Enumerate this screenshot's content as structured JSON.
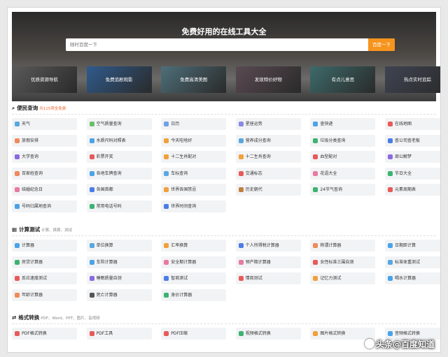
{
  "hero": {
    "title": "免费好用的在线工具大全",
    "search_placeholder": "随时百度一下",
    "search_button": "百度一下"
  },
  "categories": [
    {
      "label": "优质资源导航",
      "color": "#5a5a5a"
    },
    {
      "label": "免费追剧观影",
      "color": "#2f5b8c"
    },
    {
      "label": "免费高清美图",
      "color": "#4e6f7a"
    },
    {
      "label": "发现特价好物",
      "color": "#5a4a52"
    },
    {
      "label": "有点儿意思",
      "color": "#3d6a6a"
    },
    {
      "label": "热点实时追踪",
      "color": "#3f4452"
    }
  ],
  "sections": [
    {
      "title": "便民查询",
      "badge": "共115项全免费",
      "sub": "",
      "icon": "search-icon",
      "items": [
        {
          "label": "天气",
          "color": "#5aa7e0"
        },
        {
          "label": "空气质量查询",
          "color": "#6bbf6b"
        },
        {
          "label": "日历",
          "color": "#6fa0e8"
        },
        {
          "label": "星座运势",
          "color": "#8a8ae0"
        },
        {
          "label": "查快递",
          "color": "#4aa3e8"
        },
        {
          "label": "在线地图",
          "color": "#e85a5a"
        },
        {
          "label": "放假安排",
          "color": "#f08a5a"
        },
        {
          "label": "水质尺码对照表",
          "color": "#4aa3e8"
        },
        {
          "label": "今天吃啥好",
          "color": "#f0a03c"
        },
        {
          "label": "营养成分查询",
          "color": "#5aa7e0"
        },
        {
          "label": "垃圾分类查询",
          "color": "#3cb371"
        },
        {
          "label": "查公司查老板",
          "color": "#4a7de8"
        },
        {
          "label": "大学查询",
          "color": "#8a6ae0"
        },
        {
          "label": "彩票开奖",
          "color": "#e85a5a"
        },
        {
          "label": "十二生肖配对",
          "color": "#f0a03c"
        },
        {
          "label": "十二生肖查询",
          "color": "#f0a03c"
        },
        {
          "label": "血型配对",
          "color": "#e85a5a"
        },
        {
          "label": "周公解梦",
          "color": "#8a6ae0"
        },
        {
          "label": "百家姓查询",
          "color": "#f08a5a"
        },
        {
          "label": "各地车牌查询",
          "color": "#4aa3e8"
        },
        {
          "label": "车标查询",
          "color": "#5aa7e0"
        },
        {
          "label": "交通标志",
          "color": "#e85a5a"
        },
        {
          "label": "花语大全",
          "color": "#e87aa0"
        },
        {
          "label": "节日大全",
          "color": "#3cb371"
        },
        {
          "label": "结婚纪念日",
          "color": "#e87aa0"
        },
        {
          "label": "各国首都",
          "color": "#4a7de8"
        },
        {
          "label": "世界各国禁忌",
          "color": "#f0a03c"
        },
        {
          "label": "历史朝代",
          "color": "#c08040"
        },
        {
          "label": "24节气查询",
          "color": "#3cb371"
        },
        {
          "label": "元素周期表",
          "color": "#e85a5a"
        },
        {
          "label": "号码归属地查询",
          "color": "#4aa3e8"
        },
        {
          "label": "常用电话号码",
          "color": "#3cb371"
        },
        {
          "label": "世界时间查询",
          "color": "#4a7de8"
        }
      ]
    },
    {
      "title": "计算测试",
      "badge": "",
      "sub": "计算、换算、测试",
      "icon": "calculator-icon",
      "items": [
        {
          "label": "计算器",
          "color": "#4aa3e8"
        },
        {
          "label": "单位换算",
          "color": "#5aa7e0"
        },
        {
          "label": "汇率换算",
          "color": "#f0a03c"
        },
        {
          "label": "个人所得税计算器",
          "color": "#4a7de8"
        },
        {
          "label": "称谓计算器",
          "color": "#f08a5a"
        },
        {
          "label": "日期距计算",
          "color": "#4aa3e8"
        },
        {
          "label": "房贷计算器",
          "color": "#3cb371"
        },
        {
          "label": "车险计算器",
          "color": "#4aa3e8"
        },
        {
          "label": "安全期计算器",
          "color": "#e87aa0"
        },
        {
          "label": "预产期计算器",
          "color": "#e87aa0"
        },
        {
          "label": "女性标准三围自测",
          "color": "#e85a5a"
        },
        {
          "label": "标准体重测试",
          "color": "#5aa7e0"
        },
        {
          "label": "反应速度测试",
          "color": "#e85a5a"
        },
        {
          "label": "睡眠质量自测",
          "color": "#8a6ae0"
        },
        {
          "label": "智商测试",
          "color": "#4a7de8"
        },
        {
          "label": "情商测试",
          "color": "#e85a5a"
        },
        {
          "label": "记忆力测试",
          "color": "#f0a03c"
        },
        {
          "label": "喝水计算器",
          "color": "#4aa3e8"
        },
        {
          "label": "年龄计算器",
          "color": "#f08a5a"
        },
        {
          "label": "死亡计算器",
          "color": "#555555"
        },
        {
          "label": "身价计算器",
          "color": "#3cb371"
        }
      ]
    },
    {
      "title": "格式转换",
      "badge": "",
      "sub": "PDF、Word、PPT、图片、音视频",
      "icon": "convert-icon",
      "items": [
        {
          "label": "PDF格式转换",
          "color": "#e85a5a"
        },
        {
          "label": "PDF工具",
          "color": "#e85a5a"
        },
        {
          "label": "PDF压缩",
          "color": "#e85a5a"
        },
        {
          "label": "视频格式转换",
          "color": "#3cb371"
        },
        {
          "label": "图片格式转换",
          "color": "#f0a03c"
        },
        {
          "label": "音频格式转换",
          "color": "#4aa3e8"
        }
      ]
    }
  ],
  "watermark": "头条@百度知道"
}
